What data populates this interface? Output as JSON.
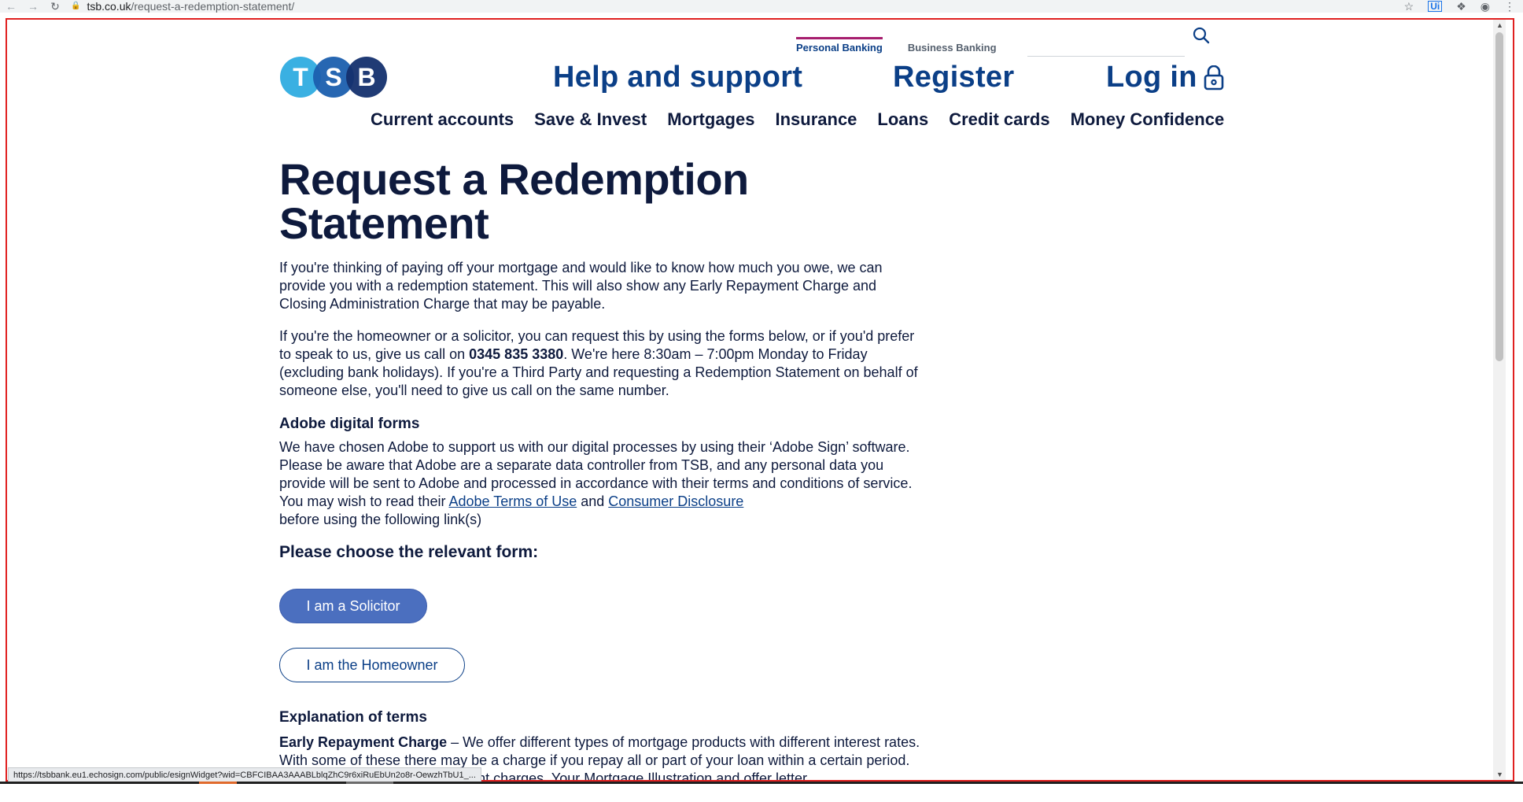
{
  "browser": {
    "url_host": "tsb.co.uk",
    "url_path": "/request-a-redemption-statement/"
  },
  "header": {
    "segment_tabs": [
      "Personal Banking",
      "Business Banking"
    ],
    "logo_letters": [
      "T",
      "S",
      "B"
    ],
    "primary_links": {
      "help": "Help and support",
      "register": "Register",
      "login": "Log in"
    },
    "product_nav": [
      "Current accounts",
      "Save & Invest",
      "Mortgages",
      "Insurance",
      "Loans",
      "Credit cards",
      "Money Confidence"
    ]
  },
  "main": {
    "title": "Request a Redemption Statement",
    "intro": "If you're thinking of paying off your mortgage and would like to know how much you owe, we can provide you with a redemption statement. This will also show any Early Repayment Charge and Closing Administration Charge that may be payable.",
    "contact_before": "If you're the homeowner or a solicitor, you can request this by using the forms below, or if you'd prefer to speak to us, give us call on ",
    "phone": "0345 835 3380",
    "contact_after": ". We're here 8:30am – 7:00pm Monday to Friday (excluding bank holidays). If you're a Third Party and requesting a Redemption Statement on behalf of someone else, you'll need to give us call on the same number.",
    "adobe_heading": "Adobe digital forms",
    "adobe_text_before": "We have chosen Adobe to support us with our digital processes by using their ‘Adobe Sign’ software. Please be aware that Adobe are a separate data controller from TSB, and any personal data you provide will be sent to Adobe and processed in accordance with their terms and conditions of service. You may wish to read their ",
    "adobe_terms_link": "Adobe Terms of Use",
    "adobe_and": " and ",
    "consumer_disclosure_link": "Consumer Disclosure",
    "adobe_text_after": " before using the following link(s)",
    "choose_heading": "Please choose the relevant form:",
    "button_solicitor": "I am a Solicitor",
    "button_homeowner": "I am the Homeowner",
    "explanation_heading": "Explanation of terms",
    "erc_term": "Early Repayment Charge",
    "erc_text": " – We offer different types of mortgage products with different interest rates. With some of these there may be a charge if you repay all or part of your loan within a certain period. These are called early repayment charges. Your Mortgage Illustration and offer letter"
  },
  "status_bar": {
    "hover_url": "https://tsbbank.eu1.echosign.com/public/esignWidget?wid=CBFCIBAA3AAABLblqZhC9r6xiRuEbUn2o8r-OewzhTbU1_..."
  },
  "colors": {
    "brand_navy": "#0b3f87",
    "text": "#0e1a3d",
    "button_fill": "#4b6fbf",
    "active_tab_accent": "#a61e6e",
    "logo_t": "#3ab0e2",
    "logo_s": "#1b5fae",
    "logo_b": "#14306e",
    "frame_red": "#e02020"
  }
}
